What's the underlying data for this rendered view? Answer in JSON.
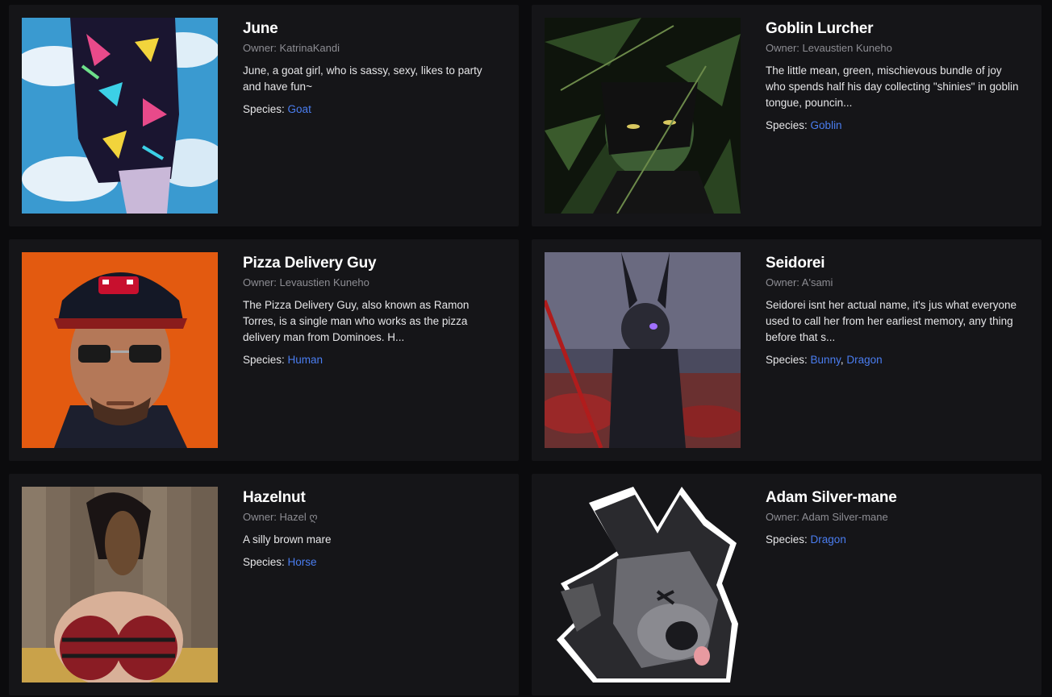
{
  "cards": [
    {
      "name": "June",
      "owner": "Owner: KatrinaKandi",
      "description": "June, a goat girl, who is sassy, sexy, likes to party and have fun~",
      "species_label": "Species:",
      "species": [
        "Goat"
      ]
    },
    {
      "name": "Goblin Lurcher",
      "owner": "Owner: Levaustien Kuneho",
      "description": "The little mean, green, mischievous bundle of joy who spends half his day collecting \"shinies\" in goblin tongue, pouncin...",
      "species_label": "Species:",
      "species": [
        "Goblin"
      ]
    },
    {
      "name": "Pizza Delivery Guy",
      "owner": "Owner: Levaustien Kuneho",
      "description": "The Pizza Delivery Guy, also known as Ramon Torres, is a single man who works as the pizza delivery man from Dominoes. H...",
      "species_label": "Species:",
      "species": [
        "Human"
      ]
    },
    {
      "name": "Seidorei",
      "owner": "Owner: A'sami",
      "description": "Seidorei isnt her actual name, it's jus what everyone used to call her from her earliest memory, any thing before that s...",
      "species_label": "Species:",
      "species": [
        "Bunny",
        "Dragon"
      ]
    },
    {
      "name": "Hazelnut",
      "owner": "Owner: Hazel ღ",
      "description": "A silly brown mare",
      "species_label": "Species:",
      "species": [
        "Horse"
      ]
    },
    {
      "name": "Adam Silver-mane",
      "owner": "Owner: Adam Silver-mane",
      "description": "",
      "species_label": "Species:",
      "species": [
        "Dragon"
      ]
    }
  ],
  "colors": {
    "background": "#0b0b0d",
    "card": "#151518",
    "link": "#4a7df0",
    "owner_text": "#8d8d93"
  }
}
